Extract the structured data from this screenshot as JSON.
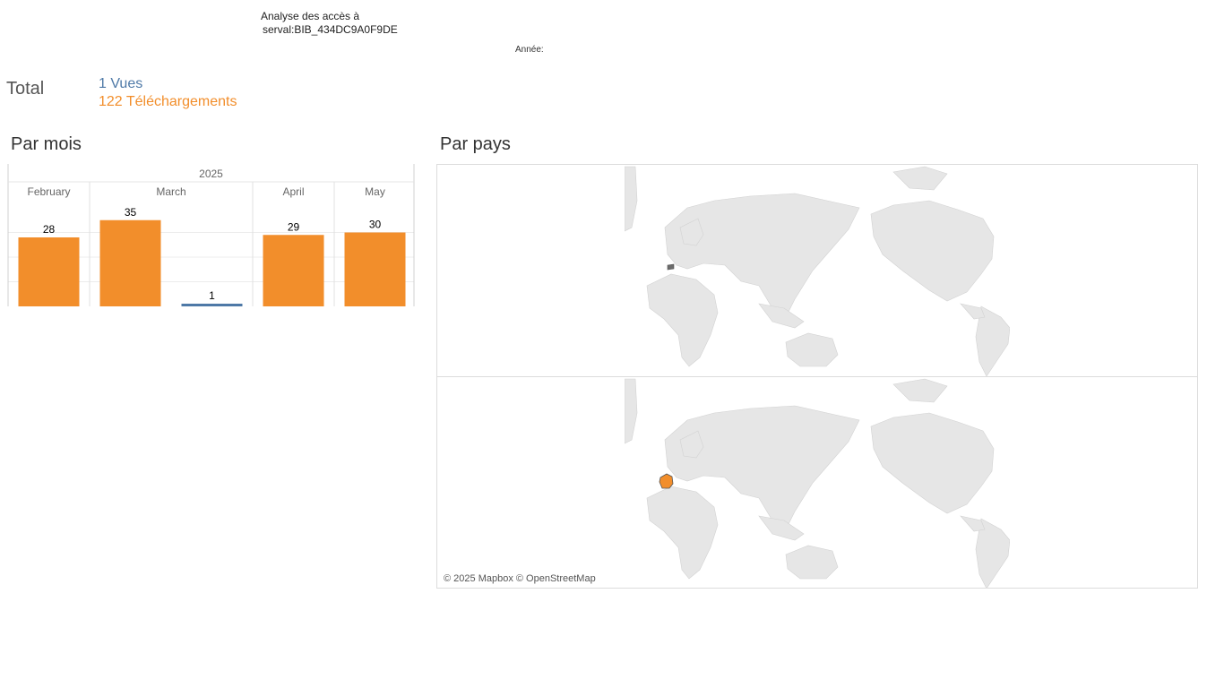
{
  "header": {
    "title_line1": "Analyse des accès à",
    "title_line2": "serval:BIB_434DC9A0F9DE",
    "year_filter_label": "Année:"
  },
  "totals": {
    "label": "Total",
    "views": "1 Vues",
    "downloads": "122 Téléchargements"
  },
  "colors": {
    "views": "#4e79a7",
    "downloads": "#f28e2b",
    "land": "#e6e6e6",
    "highlight_views": "#6b6b6b",
    "highlight_downloads": "#f28e2b"
  },
  "sections": {
    "by_month": "Par mois",
    "by_country": "Par pays"
  },
  "map": {
    "attribution": "© 2025 Mapbox © OpenStreetMap",
    "panes": [
      {
        "measure": "Vues",
        "highlighted_region": "Switzerland"
      },
      {
        "measure": "Téléchargements",
        "highlighted_region": "France"
      }
    ]
  },
  "chart_data": {
    "type": "bar",
    "year": "2025",
    "months": [
      {
        "label": "February",
        "bars": [
          {
            "series": "Téléchargements",
            "value": 28
          }
        ]
      },
      {
        "label": "March",
        "bars": [
          {
            "series": "Téléchargements",
            "value": 35
          },
          {
            "series": "Vues",
            "value": 1
          }
        ]
      },
      {
        "label": "April",
        "bars": [
          {
            "series": "Téléchargements",
            "value": 29
          }
        ]
      },
      {
        "label": "May",
        "bars": [
          {
            "series": "Téléchargements",
            "value": 30
          }
        ]
      }
    ],
    "ylim": [
      0,
      40
    ],
    "grid": true
  }
}
